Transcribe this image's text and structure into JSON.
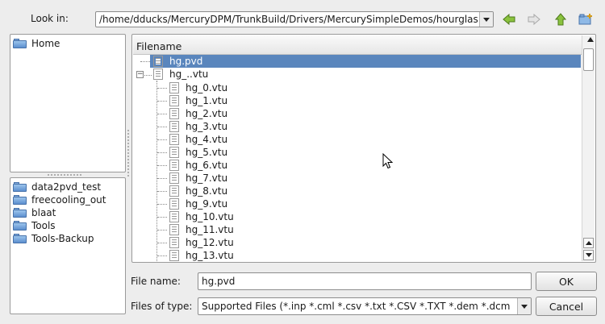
{
  "lookin": {
    "label": "Look in:",
    "path": "/home/dducks/MercuryDPM/TrunkBuild/Drivers/MercurySimpleDemos/hourglass"
  },
  "toolbar": {
    "back": "back-arrow-icon",
    "forward": "forward-arrow-icon",
    "up": "up-arrow-icon",
    "new_folder": "new-folder-icon"
  },
  "sidebar": {
    "places": [
      {
        "label": "Home"
      }
    ],
    "bookmarks": [
      {
        "label": "data2pvd_test"
      },
      {
        "label": "freecooling_out"
      },
      {
        "label": "blaat"
      },
      {
        "label": "Tools"
      },
      {
        "label": "Tools-Backup"
      }
    ]
  },
  "filelist": {
    "header": "Filename",
    "items": [
      {
        "label": "hg.pvd",
        "selected": true
      },
      {
        "label": "hg_..vtu",
        "expanded": true
      },
      {
        "label": "hg_0.vtu"
      },
      {
        "label": "hg_1.vtu"
      },
      {
        "label": "hg_2.vtu"
      },
      {
        "label": "hg_3.vtu"
      },
      {
        "label": "hg_4.vtu"
      },
      {
        "label": "hg_5.vtu"
      },
      {
        "label": "hg_6.vtu"
      },
      {
        "label": "hg_7.vtu"
      },
      {
        "label": "hg_8.vtu"
      },
      {
        "label": "hg_9.vtu"
      },
      {
        "label": "hg_10.vtu"
      },
      {
        "label": "hg_11.vtu"
      },
      {
        "label": "hg_12.vtu"
      },
      {
        "label": "hg_13.vtu"
      }
    ]
  },
  "form": {
    "filename_label": "File name:",
    "filename_value": "hg.pvd",
    "filetype_label": "Files of type:",
    "filetype_value": "Supported Files (*.inp  *.cml  *.csv *.txt *.CSV *.TXT  *.dem  *.dcm"
  },
  "buttons": {
    "ok": "OK",
    "cancel": "Cancel"
  },
  "colors": {
    "selection": "#5a86bd",
    "arrow_green": "#6aa52b"
  }
}
